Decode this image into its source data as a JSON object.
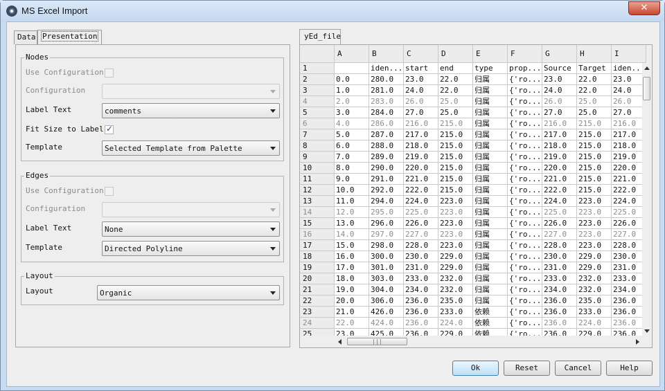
{
  "window": {
    "title": "MS Excel Import"
  },
  "tabs": [
    {
      "label": "Data"
    },
    {
      "label": "Presentation"
    }
  ],
  "nodes": {
    "legend": "Nodes",
    "use_configuration_label": "Use Configuration",
    "configuration_label": "Configuration",
    "label_text_label": "Label Text",
    "label_text_value": "comments",
    "fit_size_label": "Fit Size to Label",
    "template_label": "Template",
    "template_value": "Selected Template from Palette"
  },
  "edges": {
    "legend": "Edges",
    "use_configuration_label": "Use Configuration",
    "configuration_label": "Configuration",
    "label_text_label": "Label Text",
    "label_text_value": "None",
    "template_label": "Template",
    "template_value": "Directed Polyline"
  },
  "layout": {
    "legend": "Layout",
    "layout_label": "Layout",
    "layout_value": "Organic"
  },
  "sheet": {
    "tab_label": "yEd_file",
    "columns": [
      "A",
      "B",
      "C",
      "D",
      "E",
      "F",
      "G",
      "H",
      "I"
    ],
    "row_numbers": [
      "1",
      "2",
      "3",
      "4",
      "5",
      "6",
      "7",
      "8",
      "9",
      "10",
      "11",
      "12",
      "13",
      "14",
      "15",
      "16",
      "17",
      "18",
      "19",
      "20",
      "21",
      "22",
      "23",
      "24",
      "25"
    ],
    "gray_rows": [
      "4",
      "6",
      "14",
      "16",
      "24"
    ],
    "rows": [
      [
        "",
        "iden...",
        "start",
        "end",
        "type",
        "prop...",
        "Source",
        "Target",
        "iden..."
      ],
      [
        "0.0",
        "280.0",
        "23.0",
        "22.0",
        "归属",
        "{'ro...",
        "23.0",
        "22.0",
        "23.0"
      ],
      [
        "1.0",
        "281.0",
        "24.0",
        "22.0",
        "归属",
        "{'ro...",
        "24.0",
        "22.0",
        "24.0"
      ],
      [
        "2.0",
        "283.0",
        "26.0",
        "25.0",
        "归属",
        "{'ro...",
        "26.0",
        "25.0",
        "26.0"
      ],
      [
        "3.0",
        "284.0",
        "27.0",
        "25.0",
        "归属",
        "{'ro...",
        "27.0",
        "25.0",
        "27.0"
      ],
      [
        "4.0",
        "286.0",
        "216.0",
        "215.0",
        "归属",
        "{'ro...",
        "216.0",
        "215.0",
        "216.0"
      ],
      [
        "5.0",
        "287.0",
        "217.0",
        "215.0",
        "归属",
        "{'ro...",
        "217.0",
        "215.0",
        "217.0"
      ],
      [
        "6.0",
        "288.0",
        "218.0",
        "215.0",
        "归属",
        "{'ro...",
        "218.0",
        "215.0",
        "218.0"
      ],
      [
        "7.0",
        "289.0",
        "219.0",
        "215.0",
        "归属",
        "{'ro...",
        "219.0",
        "215.0",
        "219.0"
      ],
      [
        "8.0",
        "290.0",
        "220.0",
        "215.0",
        "归属",
        "{'ro...",
        "220.0",
        "215.0",
        "220.0"
      ],
      [
        "9.0",
        "291.0",
        "221.0",
        "215.0",
        "归属",
        "{'ro...",
        "221.0",
        "215.0",
        "221.0"
      ],
      [
        "10.0",
        "292.0",
        "222.0",
        "215.0",
        "归属",
        "{'ro...",
        "222.0",
        "215.0",
        "222.0"
      ],
      [
        "11.0",
        "294.0",
        "224.0",
        "223.0",
        "归属",
        "{'ro...",
        "224.0",
        "223.0",
        "224.0"
      ],
      [
        "12.0",
        "295.0",
        "225.0",
        "223.0",
        "归属",
        "{'ro...",
        "225.0",
        "223.0",
        "225.0"
      ],
      [
        "13.0",
        "296.0",
        "226.0",
        "223.0",
        "归属",
        "{'ro...",
        "226.0",
        "223.0",
        "226.0"
      ],
      [
        "14.0",
        "297.0",
        "227.0",
        "223.0",
        "归属",
        "{'ro...",
        "227.0",
        "223.0",
        "227.0"
      ],
      [
        "15.0",
        "298.0",
        "228.0",
        "223.0",
        "归属",
        "{'ro...",
        "228.0",
        "223.0",
        "228.0"
      ],
      [
        "16.0",
        "300.0",
        "230.0",
        "229.0",
        "归属",
        "{'ro...",
        "230.0",
        "229.0",
        "230.0"
      ],
      [
        "17.0",
        "301.0",
        "231.0",
        "229.0",
        "归属",
        "{'ro...",
        "231.0",
        "229.0",
        "231.0"
      ],
      [
        "18.0",
        "303.0",
        "233.0",
        "232.0",
        "归属",
        "{'ro...",
        "233.0",
        "232.0",
        "233.0"
      ],
      [
        "19.0",
        "304.0",
        "234.0",
        "232.0",
        "归属",
        "{'ro...",
        "234.0",
        "232.0",
        "234.0"
      ],
      [
        "20.0",
        "306.0",
        "236.0",
        "235.0",
        "归属",
        "{'ro...",
        "236.0",
        "235.0",
        "236.0"
      ],
      [
        "21.0",
        "426.0",
        "236.0",
        "233.0",
        "依赖",
        "{'ro...",
        "236.0",
        "233.0",
        "236.0"
      ],
      [
        "22.0",
        "424.0",
        "236.0",
        "224.0",
        "依赖",
        "{'ro...",
        "236.0",
        "224.0",
        "236.0"
      ],
      [
        "23.0",
        "425.0",
        "236.0",
        "229.0",
        "依赖",
        "{'ro...",
        "236.0",
        "229.0",
        "236.0"
      ]
    ]
  },
  "buttons": {
    "ok": "Ok",
    "reset": "Reset",
    "cancel": "Cancel",
    "help": "Help"
  },
  "icons": {
    "close": "close-icon",
    "check": "checkmark-icon"
  }
}
